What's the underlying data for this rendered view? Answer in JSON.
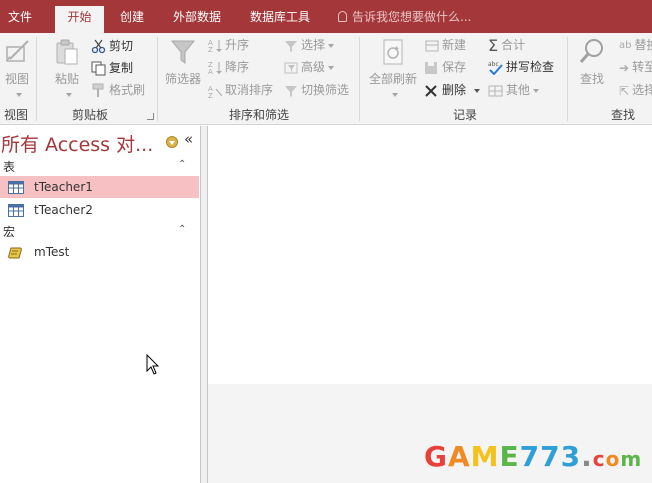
{
  "tabs": [
    {
      "label": "文件"
    },
    {
      "label": "开始"
    },
    {
      "label": "创建"
    },
    {
      "label": "外部数据"
    },
    {
      "label": "数据库工具"
    }
  ],
  "tell_me": "告诉我您想要做什么...",
  "ribbon": {
    "view": {
      "button": "视图",
      "group": "视图"
    },
    "clipboard": {
      "paste": "粘贴",
      "cut": "剪切",
      "copy": "复制",
      "format_painter": "格式刷",
      "group": "剪贴板"
    },
    "sort_filter": {
      "filter": "筛选器",
      "ascending": "升序",
      "descending": "降序",
      "clear_sort": "取消排序",
      "selection": "选择",
      "advanced": "高级",
      "toggle_filter": "切换筛选",
      "group": "排序和筛选"
    },
    "records": {
      "refresh_all": "全部刷新",
      "new": "新建",
      "save": "保存",
      "delete": "删除",
      "totals": "合计",
      "spelling": "拼写检查",
      "more": "其他",
      "group": "记录"
    },
    "find": {
      "find": "查找",
      "replace": "替换",
      "goto": "转至",
      "select": "选择",
      "group": "查找"
    }
  },
  "nav": {
    "title": "所有 Access 对...",
    "collapse_glyph": "«",
    "sections": [
      {
        "label": "表",
        "items": [
          "tTeacher1",
          "tTeacher2"
        ]
      },
      {
        "label": "宏",
        "items": [
          "mTest"
        ]
      }
    ]
  },
  "watermark": {
    "letters": [
      "G",
      "A",
      "M",
      "E",
      "7",
      "7",
      "3",
      ".",
      "c",
      "o",
      "m"
    ],
    "colors": [
      "#e8413c",
      "#f08a24",
      "#f5c21c",
      "#5bb64a",
      "#2f9fd8",
      "#2f9fd8",
      "#2f9fd8",
      "#888888",
      "#e8413c",
      "#f08a24",
      "#5bb64a"
    ]
  }
}
